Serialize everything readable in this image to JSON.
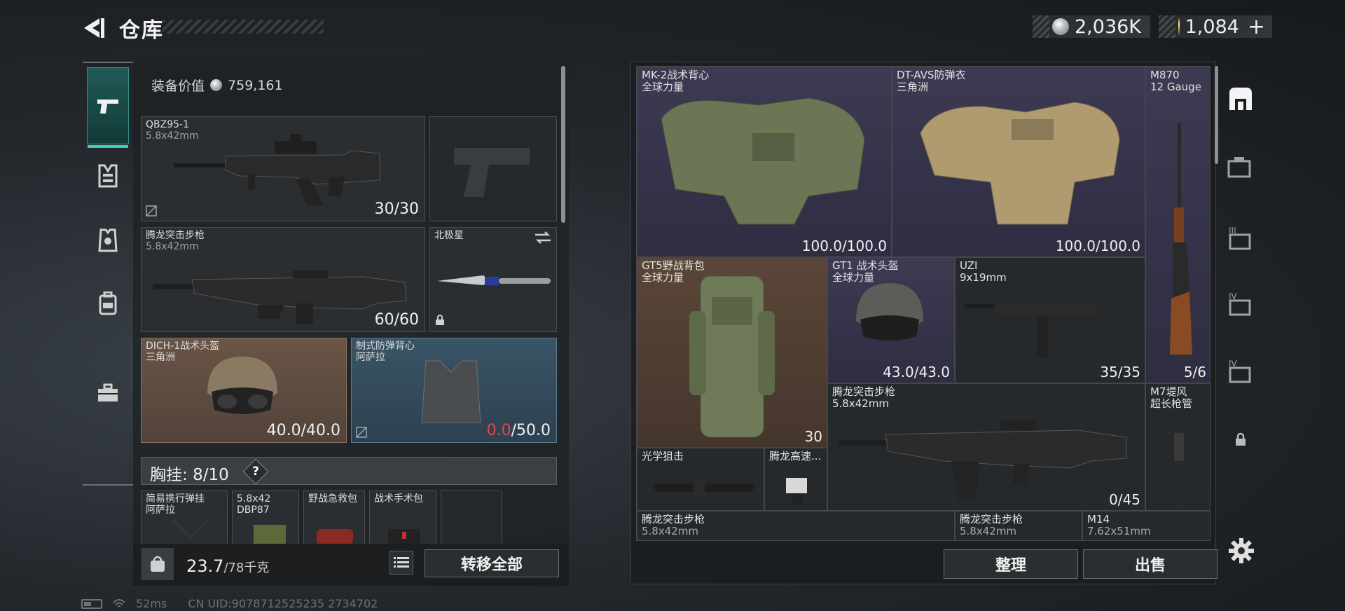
{
  "header": {
    "title": "仓库",
    "currency_silver": "2,036K",
    "currency_gold": "1,084",
    "plus_label": "+"
  },
  "left_panel": {
    "equip_value_label": "装备价值",
    "equip_value": "759,161",
    "slots": {
      "primary": {
        "name": "QBZ95-1",
        "caliber": "5.8x42mm",
        "count": "30/30"
      },
      "secondary": {
        "name": "腾龙突击步枪",
        "caliber": "5.8x42mm",
        "count": "60/60"
      },
      "melee": {
        "name": "北极星"
      },
      "helmet": {
        "name": "DICH-1战术头盔",
        "maker": "三角洲",
        "durability": "40.0/40.0"
      },
      "armor": {
        "name": "制式防弹背心",
        "maker": "阿萨拉",
        "durability_current": "0.0",
        "durability_max": "/50.0"
      }
    },
    "chest_rig": {
      "label": "胸挂:",
      "capacity": "8/10",
      "help": "?"
    },
    "rig_items": [
      {
        "name": "简易携行弹挂",
        "maker": "阿萨拉"
      },
      {
        "name": "5.8x42",
        "maker": "DBP87"
      },
      {
        "name": "野战急救包"
      },
      {
        "name": "战术手术包"
      }
    ],
    "weight_current": "23.7",
    "weight_max": "/78千克",
    "transfer_all": "转移全部"
  },
  "stash": {
    "items": [
      {
        "name": "MK-2战术背心",
        "maker": "全球力量",
        "count": "100.0/100.0"
      },
      {
        "name": "DT-AVS防弹衣",
        "maker": "三角洲",
        "count": "100.0/100.0"
      },
      {
        "name": "M870",
        "maker": "12 Gauge",
        "count": "5/6"
      },
      {
        "name": "GT5野战背包",
        "maker": "全球力量",
        "count": "30"
      },
      {
        "name": "GT1 战术头盔",
        "maker": "全球力量",
        "count": "43.0/43.0"
      },
      {
        "name": "UZI",
        "maker": "9x19mm",
        "count": "35/35"
      },
      {
        "name": "腾龙突击步枪",
        "maker": "5.8x42mm",
        "count": "0/45"
      },
      {
        "name": "M7堤风",
        "maker": "超长枪管"
      },
      {
        "name": "光学狙击"
      },
      {
        "name": "腾龙高速..."
      },
      {
        "name": "腾龙突击步枪",
        "maker": "5.8x42mm"
      },
      {
        "name": "腾龙突击步枪",
        "maker": "5.8x42mm"
      },
      {
        "name": "M14",
        "maker": "7.62x51mm"
      }
    ],
    "arrange_label": "整理",
    "sell_label": "出售"
  },
  "status_bar": {
    "ping": "52ms",
    "uid": "CN UID:9078712525235 2734702"
  },
  "colors": {
    "accent_teal": "#3fd0b8",
    "durability_broken": "#e04848",
    "cell_purple": "#3d3a52",
    "cell_brown": "#5a4638"
  },
  "icons": [
    "back-arrow-icon",
    "silver-coin-icon",
    "gold-coin-icon",
    "pistol-icon",
    "vest-icon",
    "helmet-icon",
    "backpack-icon",
    "toolbox-icon",
    "lock-icon",
    "swap-icon",
    "weight-icon",
    "list-icon",
    "settings-icon"
  ]
}
